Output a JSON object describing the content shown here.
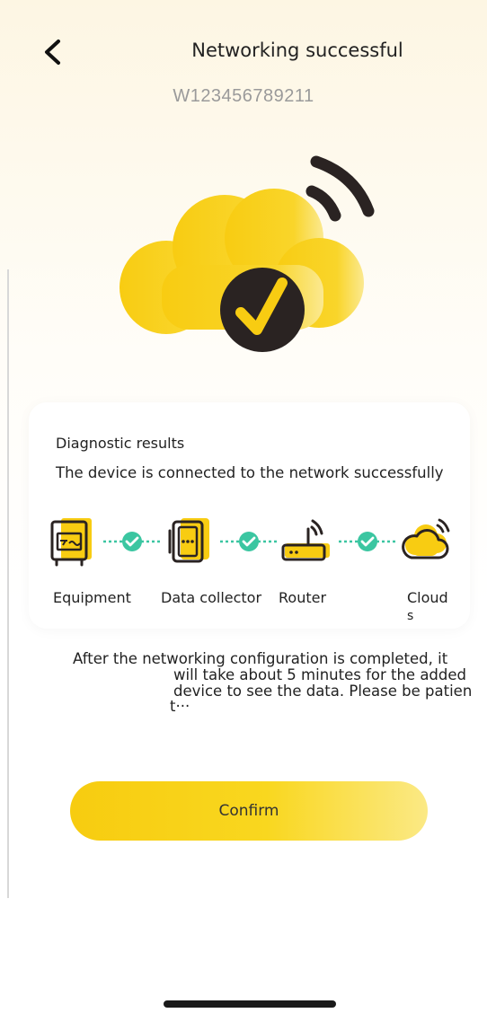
{
  "header": {
    "title": "Networking successful",
    "back_icon": "chevron-left-icon",
    "device_id": "W123456789211"
  },
  "hero": {
    "icon": "cloud-check-wifi-icon",
    "accent": "#f8cc12",
    "dark": "#2a2322"
  },
  "diagnostics": {
    "title": "Diagnostic results",
    "status": "The device is connected to the network successfully",
    "steps": [
      {
        "label": "Equipment",
        "icon": "inverter-icon"
      },
      {
        "label": "Data collector",
        "icon": "data-collector-icon"
      },
      {
        "label": "Router",
        "icon": "router-icon"
      },
      {
        "label_line1": "Cloud",
        "label_line2": "s",
        "icon": "cloud-icon"
      }
    ],
    "check_color": "#3bc6a1"
  },
  "notice": {
    "line1": "After the networking configuration is completed, it",
    "line2": "will take about 5 minutes for the added",
    "line3": "device to see the data. Please be patien",
    "line4": "t···"
  },
  "confirm_label": "Confirm"
}
